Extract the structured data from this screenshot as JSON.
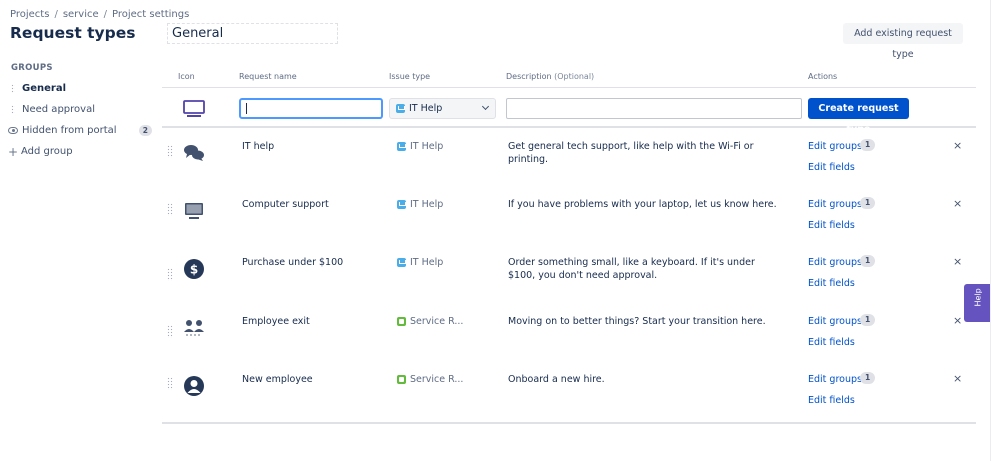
{
  "breadcrumb": [
    "Projects",
    "service",
    "Project settings"
  ],
  "page_title": "Request types",
  "group_name": "General",
  "add_existing_label": "Add existing request type",
  "sidebar": {
    "heading": "GROUPS",
    "items": [
      {
        "label": "General",
        "active": true
      },
      {
        "label": "Need approval"
      },
      {
        "label": "Hidden from portal",
        "count": "2"
      },
      {
        "label": "Add group"
      }
    ]
  },
  "columns": {
    "icon": "Icon",
    "name": "Request name",
    "issue": "Issue type",
    "desc": "Description",
    "desc_optional": "(Optional)",
    "actions": "Actions"
  },
  "create_row": {
    "name_value": "",
    "issue_value": "IT Help",
    "desc_value": "",
    "button_label": "Create request type"
  },
  "actions": {
    "edit_groups": "Edit groups",
    "edit_fields": "Edit fields",
    "remove": "×"
  },
  "request_types": [
    {
      "icon": "chat-bubbles-icon",
      "name": "IT help",
      "issue": "IT Help",
      "issue_kind": "it",
      "desc": "Get general tech support, like help with the Wi-Fi or printing.",
      "groups": "1"
    },
    {
      "icon": "monitor-icon",
      "name": "Computer support",
      "issue": "IT Help",
      "issue_kind": "it",
      "desc": "If you have problems with your laptop, let us know here.",
      "groups": "1"
    },
    {
      "icon": "dollar-icon",
      "name": "Purchase under $100",
      "issue": "IT Help",
      "issue_kind": "it",
      "desc": "Order something small, like a keyboard. If it's under $100, you don't need approval.",
      "groups": "1"
    },
    {
      "icon": "people-icon",
      "name": "Employee exit",
      "issue": "Service R...",
      "issue_kind": "sr",
      "desc": "Moving on to better things? Start your transition here.",
      "groups": "1"
    },
    {
      "icon": "person-icon",
      "name": "New employee",
      "issue": "Service R...",
      "issue_kind": "sr",
      "desc": "Onboard a new hire.",
      "groups": "1"
    }
  ],
  "help_label": "Help",
  "colors": {
    "primary": "#0052cc",
    "help_tab": "#6554c0",
    "focus": "#4c9aff"
  }
}
